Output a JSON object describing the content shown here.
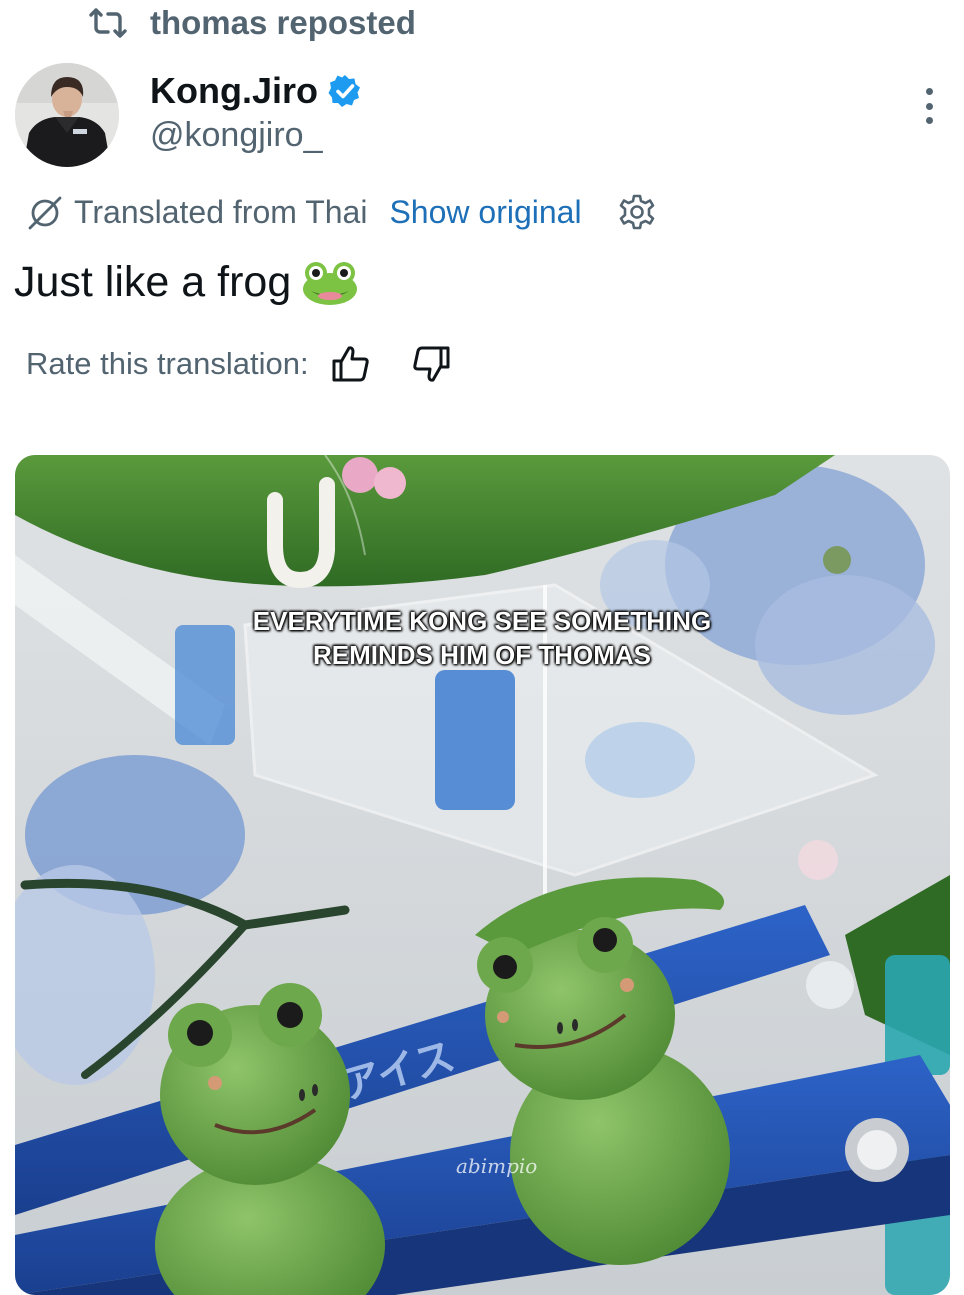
{
  "repost": {
    "text": "thomas reposted",
    "icon": "repost-icon"
  },
  "author": {
    "display_name": "Kong.Jiro",
    "handle": "@kongjiro_",
    "verified": true,
    "verified_color": "#1d9bf0"
  },
  "translation": {
    "label": "Translated from Thai",
    "show_original": "Show original",
    "link_color": "#1d70b8"
  },
  "tweet": {
    "text": "Just like a frog",
    "emoji": "frog-emoji"
  },
  "rating": {
    "label": "Rate this translation:"
  },
  "media": {
    "caption_line1": "EVERYTIME KONG SEE SOMETHING",
    "caption_line2": "REMINDS HIM OF THOMAS",
    "watermark": "abimpio",
    "bench_text": "アイス"
  }
}
